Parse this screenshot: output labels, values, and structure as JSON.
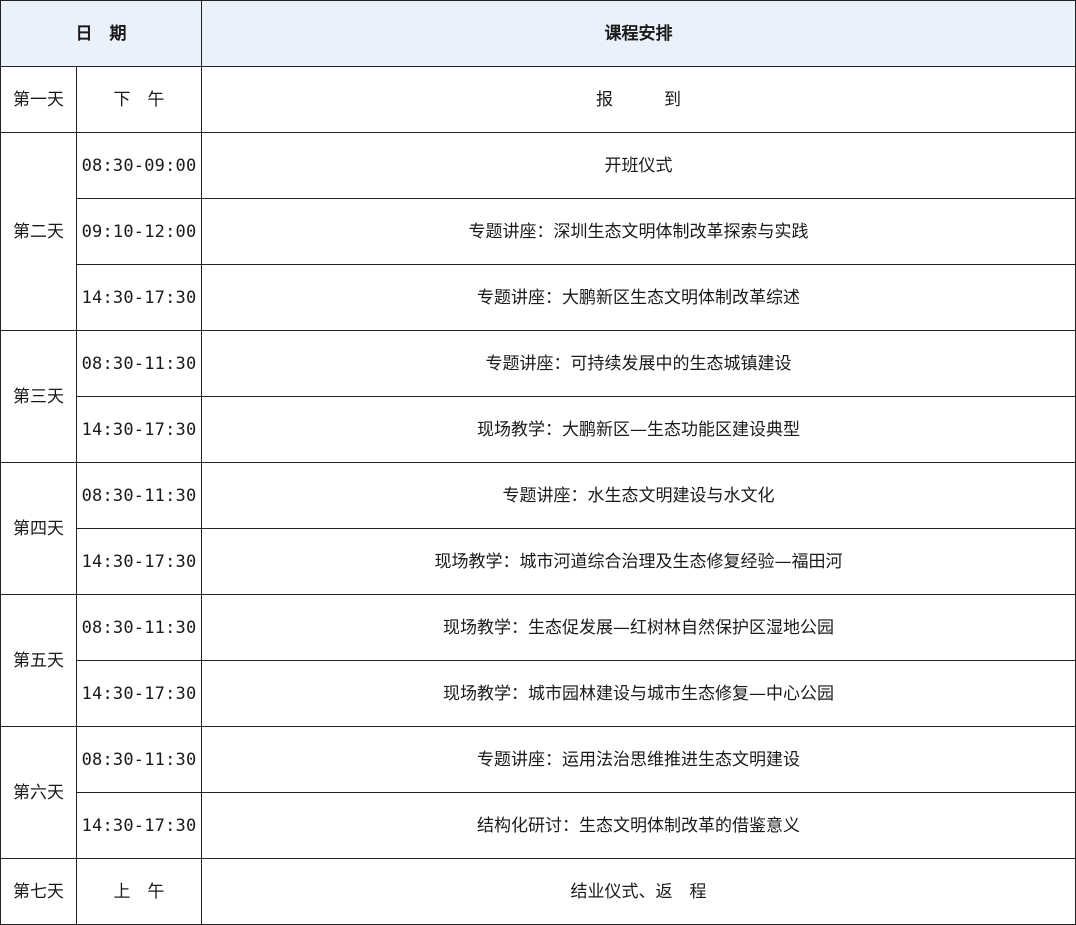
{
  "header": {
    "date_label": "日　期",
    "course_label": "课程安排"
  },
  "days": [
    {
      "day": "第一天",
      "sessions": [
        {
          "time": "下　午",
          "content": "报　　　到"
        }
      ]
    },
    {
      "day": "第二天",
      "sessions": [
        {
          "time": "08:30-09:00",
          "content": "开班仪式"
        },
        {
          "time": "09:10-12:00",
          "content": "专题讲座：深圳生态文明体制改革探索与实践"
        },
        {
          "time": "14:30-17:30",
          "content": "专题讲座：大鹏新区生态文明体制改革综述"
        }
      ]
    },
    {
      "day": "第三天",
      "sessions": [
        {
          "time": "08:30-11:30",
          "content": "专题讲座：可持续发展中的生态城镇建设"
        },
        {
          "time": "14:30-17:30",
          "content": "现场教学：大鹏新区—生态功能区建设典型"
        }
      ]
    },
    {
      "day": "第四天",
      "sessions": [
        {
          "time": "08:30-11:30",
          "content": "专题讲座：水生态文明建设与水文化"
        },
        {
          "time": "14:30-17:30",
          "content": "现场教学：城市河道综合治理及生态修复经验—福田河"
        }
      ]
    },
    {
      "day": "第五天",
      "sessions": [
        {
          "time": "08:30-11:30",
          "content": "现场教学：生态促发展—红树林自然保护区湿地公园"
        },
        {
          "time": "14:30-17:30",
          "content": "现场教学：城市园林建设与城市生态修复—中心公园"
        }
      ]
    },
    {
      "day": "第六天",
      "sessions": [
        {
          "time": "08:30-11:30",
          "content": "专题讲座：运用法治思维推进生态文明建设"
        },
        {
          "time": "14:30-17:30",
          "content": "结构化研讨：生态文明体制改革的借鉴意义"
        }
      ]
    },
    {
      "day": "第七天",
      "sessions": [
        {
          "time": "上　午",
          "content": "结业仪式、返　程"
        }
      ]
    }
  ]
}
